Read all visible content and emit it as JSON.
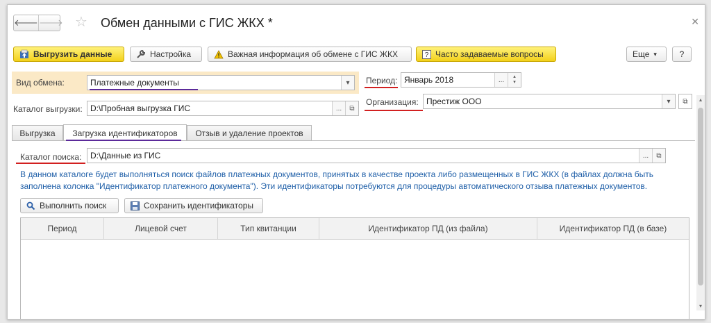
{
  "window": {
    "title": "Обмен данными с ГИС ЖКХ *"
  },
  "toolbar": {
    "upload_label": "Выгрузить данные",
    "settings_label": "Настройка",
    "important_label": "Важная информация об обмене с ГИС ЖКХ",
    "faq_label": "Часто задаваемые вопросы",
    "more_label": "Еще",
    "help_label": "?"
  },
  "form": {
    "exchange_type_label": "Вид обмена:",
    "exchange_type_value": "Платежные документы",
    "export_dir_label": "Каталог выгрузки:",
    "export_dir_value": "D:\\Пробная выгрузка ГИС",
    "period_label": "Период:",
    "period_value": "Январь 2018",
    "org_label": "Организация:",
    "org_value": "Престиж ООО"
  },
  "tabs": [
    {
      "label": "Выгрузка"
    },
    {
      "label": "Загрузка идентификаторов"
    },
    {
      "label": "Отзыв и удаление проектов"
    }
  ],
  "tab_content": {
    "search_dir_label": "Каталог поиска:",
    "search_dir_value": "D:\\Данные из ГИС",
    "info_text": "В данном каталоге будет выполняться поиск файлов платежных документов, принятых в качестве проекта либо размещенных в ГИС ЖКХ (в файлах должна быть заполнена колонка \"Идентификатор платежного документа\"). Эти идентификаторы потребуются для процедуры автоматического отзыва платежных документов.",
    "search_button": "Выполнить поиск",
    "save_ids_button": "Сохранить идентификаторы",
    "columns": [
      "Период",
      "Лицевой счет",
      "Тип квитанции",
      "Идентификатор ПД (из файла)",
      "Идентификатор ПД (в базе)"
    ]
  },
  "colors": {
    "accent_underline_red": "#d22020",
    "accent_underline_purple": "#5b2a9a",
    "highlight": "#fbe9c6",
    "info_text": "#1f5fa8"
  }
}
